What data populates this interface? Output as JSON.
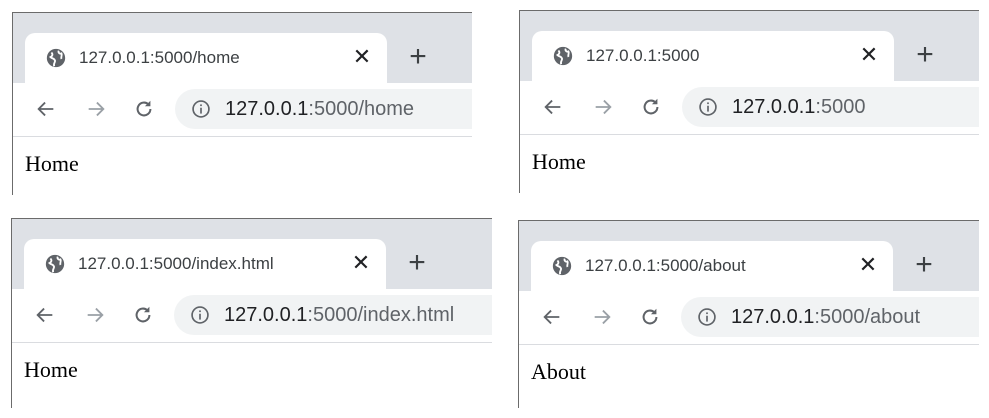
{
  "windows": [
    {
      "tab_title": "127.0.0.1:5000/home",
      "url_host": "127.0.0.1",
      "url_rest": ":5000/home",
      "page_text": "Home"
    },
    {
      "tab_title": "127.0.0.1:5000",
      "url_host": "127.0.0.1",
      "url_rest": ":5000",
      "page_text": "Home"
    },
    {
      "tab_title": "127.0.0.1:5000/index.html",
      "url_host": "127.0.0.1",
      "url_rest": ":5000/index.html",
      "page_text": "Home"
    },
    {
      "tab_title": "127.0.0.1:5000/about",
      "url_host": "127.0.0.1",
      "url_rest": ":5000/about",
      "page_text": "About"
    }
  ],
  "controls": {
    "close_glyph": "✕",
    "newtab_glyph": "+"
  },
  "icons": {
    "favicon": "globe-icon",
    "back": "arrow-left-icon",
    "forward": "arrow-right-icon",
    "reload": "reload-icon",
    "site_info": "info-icon"
  },
  "colors": {
    "tabstrip": "#dee1e6",
    "omnibox": "#f1f3f4",
    "icon": "#5f6368",
    "icon_disabled": "#9aa0a6"
  }
}
